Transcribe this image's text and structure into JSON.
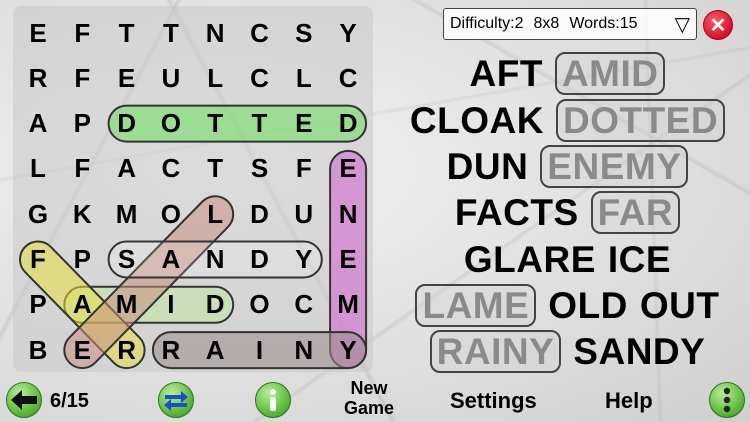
{
  "header": {
    "difficulty": "Difficulty:2",
    "grid_size": "8x8",
    "words_count": "Words:15",
    "dropdown_icon": "dropdown-triangle-icon",
    "close_icon": "close-x-icon"
  },
  "grid": {
    "rows": [
      [
        "E",
        "F",
        "T",
        "T",
        "N",
        "C",
        "S",
        "Y"
      ],
      [
        "R",
        "F",
        "E",
        "U",
        "L",
        "C",
        "L",
        "C"
      ],
      [
        "A",
        "P",
        "D",
        "O",
        "T",
        "T",
        "E",
        "D"
      ],
      [
        "L",
        "F",
        "A",
        "C",
        "T",
        "S",
        "F",
        "E"
      ],
      [
        "G",
        "K",
        "M",
        "O",
        "L",
        "D",
        "U",
        "N"
      ],
      [
        "F",
        "P",
        "S",
        "A",
        "N",
        "D",
        "Y",
        "E"
      ],
      [
        "P",
        "A",
        "M",
        "I",
        "D",
        "O",
        "C",
        "M"
      ],
      [
        "B",
        "E",
        "R",
        "R",
        "A",
        "I",
        "N",
        "Y"
      ]
    ]
  },
  "found_marks": [
    {
      "word": "DOTTED",
      "from": [
        2,
        2
      ],
      "to": [
        2,
        7
      ],
      "color": "#66e05a"
    },
    {
      "word": "ENEMY",
      "from": [
        3,
        7
      ],
      "to": [
        7,
        7
      ],
      "color": "#d060d0"
    },
    {
      "word": "AMID",
      "from": [
        6,
        1
      ],
      "to": [
        6,
        4
      ],
      "color": "#bfe89f"
    },
    {
      "word": "RAINY",
      "from": [
        7,
        3
      ],
      "to": [
        7,
        7
      ],
      "color": "#9a8a8a"
    },
    {
      "word": "FAR",
      "from": [
        5,
        0
      ],
      "to": [
        7,
        2
      ],
      "color": "#e8e040"
    },
    {
      "word": "LAME",
      "from": [
        4,
        4
      ],
      "to": [
        7,
        1
      ],
      "color": "#c89080"
    },
    {
      "word": "SANDY",
      "from": [
        5,
        2
      ],
      "to": [
        5,
        6
      ],
      "color": "#ffffff"
    }
  ],
  "word_list": [
    [
      {
        "text": "AFT",
        "found": false
      },
      {
        "text": "AMID",
        "found": true
      }
    ],
    [
      {
        "text": "CLOAK",
        "found": false
      },
      {
        "text": "DOTTED",
        "found": true
      }
    ],
    [
      {
        "text": "DUN",
        "found": false
      },
      {
        "text": "ENEMY",
        "found": true
      }
    ],
    [
      {
        "text": "FACTS",
        "found": false
      },
      {
        "text": "FAR",
        "found": true
      }
    ],
    [
      {
        "text": "GLARE",
        "found": false
      },
      {
        "text": "ICE",
        "found": false
      }
    ],
    [
      {
        "text": "LAME",
        "found": true
      },
      {
        "text": "OLD",
        "found": false
      },
      {
        "text": "OUT",
        "found": false
      }
    ],
    [
      {
        "text": "RAINY",
        "found": true
      },
      {
        "text": "SANDY",
        "found": false
      }
    ]
  ],
  "toolbar": {
    "back_icon": "arrow-left-icon",
    "progress": "6/15",
    "swap_icon": "swap-arrows-icon",
    "info_icon": "info-icon",
    "new_game_line1": "New",
    "new_game_line2": "Game",
    "settings": "Settings",
    "help": "Help",
    "more_icon": "vertical-dots-icon"
  }
}
